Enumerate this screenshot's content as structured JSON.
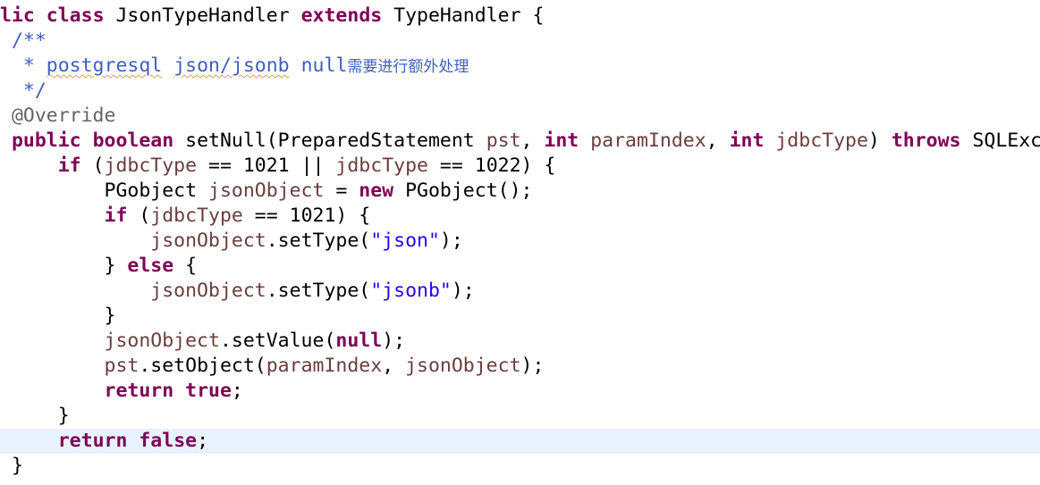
{
  "editor": {
    "lines": [
      {
        "tokens": [
          {
            "text": "lic",
            "type": "kw"
          },
          {
            "text": " ",
            "type": "plain"
          },
          {
            "text": "class",
            "type": "kw"
          },
          {
            "text": " JsonTypeHandler ",
            "type": "plain"
          },
          {
            "text": "extends",
            "type": "kw"
          },
          {
            "text": " TypeHandler {",
            "type": "plain"
          }
        ]
      },
      {
        "tokens": [
          {
            "text": " /**",
            "type": "cm"
          }
        ]
      },
      {
        "tokens": [
          {
            "text": "  * ",
            "type": "cm"
          },
          {
            "text": "postgresql",
            "type": "cmw"
          },
          {
            "text": " ",
            "type": "cm"
          },
          {
            "text": "json/jsonb",
            "type": "cmw"
          },
          {
            "text": " null",
            "type": "cm"
          },
          {
            "text": "需要进行额外处理",
            "type": "cjk"
          }
        ]
      },
      {
        "tokens": [
          {
            "text": "  */",
            "type": "cm"
          }
        ]
      },
      {
        "tokens": [
          {
            "text": " @Override",
            "type": "ann"
          }
        ]
      },
      {
        "tokens": [
          {
            "text": " ",
            "type": "plain"
          },
          {
            "text": "public",
            "type": "kw"
          },
          {
            "text": " ",
            "type": "plain"
          },
          {
            "text": "boolean",
            "type": "kw"
          },
          {
            "text": " setNull(PreparedStatement ",
            "type": "plain"
          },
          {
            "text": "pst",
            "type": "var"
          },
          {
            "text": ", ",
            "type": "plain"
          },
          {
            "text": "int",
            "type": "kw"
          },
          {
            "text": " ",
            "type": "plain"
          },
          {
            "text": "paramIndex",
            "type": "var"
          },
          {
            "text": ", ",
            "type": "plain"
          },
          {
            "text": "int",
            "type": "kw"
          },
          {
            "text": " ",
            "type": "plain"
          },
          {
            "text": "jdbcType",
            "type": "var"
          },
          {
            "text": ") ",
            "type": "plain"
          },
          {
            "text": "throws",
            "type": "kw"
          },
          {
            "text": " SQLExc",
            "type": "plain"
          }
        ]
      },
      {
        "tokens": [
          {
            "text": "     ",
            "type": "plain"
          },
          {
            "text": "if",
            "type": "kw"
          },
          {
            "text": " (",
            "type": "plain"
          },
          {
            "text": "jdbcType",
            "type": "var"
          },
          {
            "text": " == 1021 || ",
            "type": "plain"
          },
          {
            "text": "jdbcType",
            "type": "var"
          },
          {
            "text": " == 1022) {",
            "type": "plain"
          }
        ]
      },
      {
        "tokens": [
          {
            "text": "         PGobject ",
            "type": "plain"
          },
          {
            "text": "jsonObject",
            "type": "var"
          },
          {
            "text": " = ",
            "type": "plain"
          },
          {
            "text": "new",
            "type": "kw"
          },
          {
            "text": " PGobject();",
            "type": "plain"
          }
        ]
      },
      {
        "tokens": [
          {
            "text": "         ",
            "type": "plain"
          },
          {
            "text": "if",
            "type": "kw"
          },
          {
            "text": " (",
            "type": "plain"
          },
          {
            "text": "jdbcType",
            "type": "var"
          },
          {
            "text": " == 1021) {",
            "type": "plain"
          }
        ]
      },
      {
        "tokens": [
          {
            "text": "             ",
            "type": "plain"
          },
          {
            "text": "jsonObject",
            "type": "var"
          },
          {
            "text": ".setType(",
            "type": "plain"
          },
          {
            "text": "\"json\"",
            "type": "str"
          },
          {
            "text": ");",
            "type": "plain"
          }
        ]
      },
      {
        "tokens": [
          {
            "text": "         } ",
            "type": "plain"
          },
          {
            "text": "else",
            "type": "kw"
          },
          {
            "text": " {",
            "type": "plain"
          }
        ]
      },
      {
        "tokens": [
          {
            "text": "             ",
            "type": "plain"
          },
          {
            "text": "jsonObject",
            "type": "var"
          },
          {
            "text": ".setType(",
            "type": "plain"
          },
          {
            "text": "\"jsonb\"",
            "type": "str"
          },
          {
            "text": ");",
            "type": "plain"
          }
        ]
      },
      {
        "tokens": [
          {
            "text": "         }",
            "type": "plain"
          }
        ]
      },
      {
        "tokens": [
          {
            "text": "         ",
            "type": "plain"
          },
          {
            "text": "jsonObject",
            "type": "var"
          },
          {
            "text": ".setValue(",
            "type": "plain"
          },
          {
            "text": "null",
            "type": "kw"
          },
          {
            "text": ");",
            "type": "plain"
          }
        ]
      },
      {
        "tokens": [
          {
            "text": "         ",
            "type": "plain"
          },
          {
            "text": "pst",
            "type": "var"
          },
          {
            "text": ".setObject(",
            "type": "plain"
          },
          {
            "text": "paramIndex",
            "type": "var"
          },
          {
            "text": ", ",
            "type": "plain"
          },
          {
            "text": "jsonObject",
            "type": "var"
          },
          {
            "text": ");",
            "type": "plain"
          }
        ]
      },
      {
        "tokens": [
          {
            "text": "         ",
            "type": "plain"
          },
          {
            "text": "return",
            "type": "kw"
          },
          {
            "text": " ",
            "type": "plain"
          },
          {
            "text": "true",
            "type": "kw"
          },
          {
            "text": ";",
            "type": "plain"
          }
        ]
      },
      {
        "tokens": [
          {
            "text": "     }",
            "type": "plain"
          }
        ]
      },
      {
        "current": true,
        "tokens": [
          {
            "text": "     ",
            "type": "plain"
          },
          {
            "text": "return",
            "type": "kw"
          },
          {
            "text": " ",
            "type": "plain"
          },
          {
            "text": "false",
            "type": "kw"
          },
          {
            "text": ";",
            "type": "plain"
          }
        ]
      },
      {
        "tokens": [
          {
            "text": " }",
            "type": "plain"
          }
        ]
      }
    ]
  }
}
